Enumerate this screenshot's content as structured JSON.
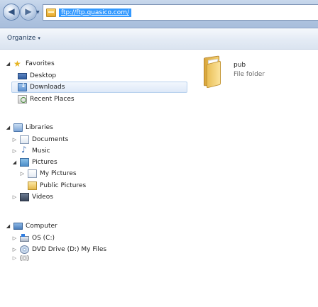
{
  "address": {
    "url": "ftp://ftp.quasico.com/"
  },
  "toolbar": {
    "organize_label": "Organize"
  },
  "nav": {
    "favorites": {
      "label": "Favorites",
      "items": [
        "Desktop",
        "Downloads",
        "Recent Places"
      ],
      "selected": "Downloads"
    },
    "libraries": {
      "label": "Libraries",
      "documents": "Documents",
      "music": "Music",
      "pictures": {
        "label": "Pictures",
        "items": [
          "My Pictures",
          "Public Pictures"
        ]
      },
      "videos": "Videos"
    },
    "computer": {
      "label": "Computer",
      "drives": [
        "OS (C:)",
        "DVD Drive (D:) My Files"
      ]
    }
  },
  "content": {
    "items": [
      {
        "name": "pub",
        "type": "File folder"
      }
    ]
  }
}
